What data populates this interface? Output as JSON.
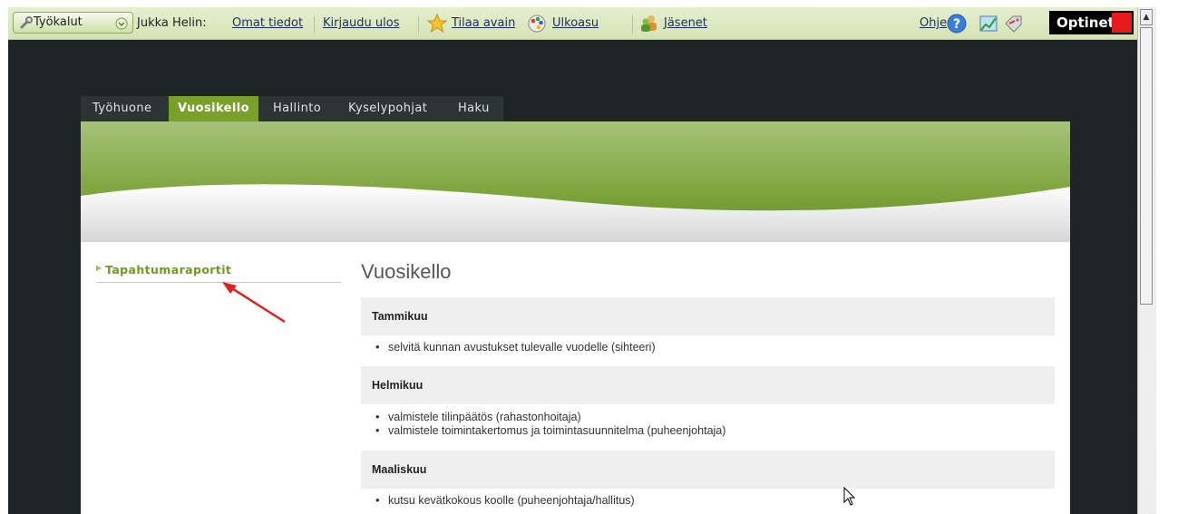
{
  "toolbar": {
    "tools_label": "Työkalut",
    "user_label": "Jukka Helin:",
    "my_info": "Omat tiedot",
    "logout": "Kirjaudu ulos",
    "order_key": "Tilaa avain",
    "appearance": "Ulkoasu",
    "members": "Jäsenet",
    "help": "Ohje",
    "brand": "Optinet"
  },
  "nav": {
    "tabs": [
      {
        "label": "Työhuone"
      },
      {
        "label": "Vuosikello",
        "active": true
      },
      {
        "label": "Hallinto"
      },
      {
        "label": "Kyselypohjat"
      },
      {
        "label": "Haku"
      }
    ]
  },
  "sidebar": {
    "link": "Tapahtumaraportit"
  },
  "main": {
    "title": "Vuosikello",
    "months": [
      {
        "name": "Tammikuu",
        "tasks": [
          "selvitä kunnan avustukset tulevalle vuodelle (sihteeri)"
        ]
      },
      {
        "name": "Helmikuu",
        "tasks": [
          "valmistele tilinpäätös (rahastonhoitaja)",
          "valmistele toimintakertomus ja toimintasuunnitelma (puheenjohtaja)"
        ]
      },
      {
        "name": "Maaliskuu",
        "tasks": [
          "kutsu kevätkokous koolle (puheenjohtaja/hallitus)"
        ]
      }
    ]
  },
  "colors": {
    "accent_green": "#7aa02c",
    "toolbar_bg": "#d5e3b4",
    "dark_bg": "#1f2424",
    "annotation_arrow": "#e0201f"
  }
}
